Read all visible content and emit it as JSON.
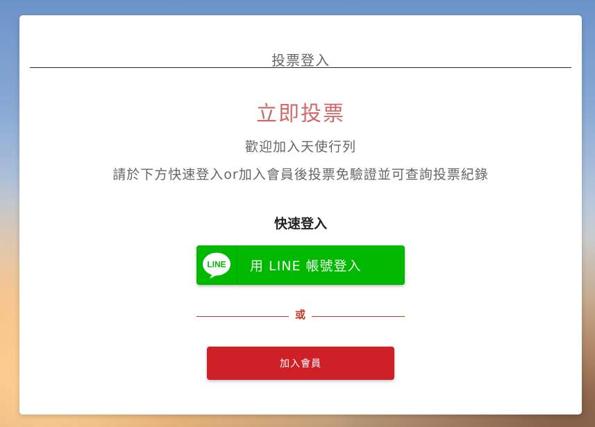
{
  "header": {
    "title": "投票登入"
  },
  "main": {
    "headline": "立即投票",
    "welcome": "歡迎加入天使行列",
    "instructions": "請於下方快速登入or加入會員後投票免驗證並可查詢投票紀錄",
    "quick_login_title": "快速登入",
    "line_button": {
      "icon_text": "LINE",
      "label": "用 LINE 帳號登入"
    },
    "divider_text": "或",
    "join_button_label": "加入會員"
  },
  "colors": {
    "headline": "#d06a6a",
    "line_green": "#00b900",
    "join_red": "#cf2027",
    "divider_red": "#c0392b"
  },
  "icons": {
    "line_button_icon": "line-logo-icon"
  }
}
